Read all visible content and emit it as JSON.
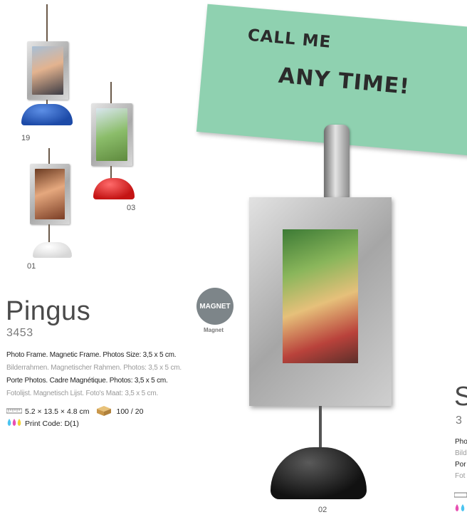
{
  "variants": [
    {
      "number": "19",
      "base_color": "#2a5fc0"
    },
    {
      "number": "03",
      "base_color": "#d82a2a"
    },
    {
      "number": "01",
      "base_color": "#f0f0f0"
    },
    {
      "number": "02",
      "base_color": "#1a1a1a"
    }
  ],
  "product": {
    "title": "Pingus",
    "code": "3453",
    "descriptions": [
      "Photo Frame. Magnetic Frame. Photos Size: 3,5 x 5 cm.",
      "Bilderrahmen. Magnetischer Rahmen. Photos: 3,5 x 5 cm.",
      "Porte Photos. Cadre Magnétique. Photos: 3,5 x 5 cm.",
      "Fotolijst. Magnetisch Lijst. Foto's Maat: 3,5 x 5 cm."
    ],
    "dimensions": "5.2 × 13.5 × 4.8 cm",
    "packaging": "100 / 20",
    "print_code": "Print Code: D(1)",
    "badge_label": "MAGNET",
    "badge_caption": "Magnet"
  },
  "note_text": {
    "line1": "CALL ME",
    "line2": "ANY TIME!"
  },
  "next_product_partial": {
    "title_letter": "S",
    "code_partial": "3",
    "line1": "Pho",
    "line2": "Bild",
    "line3": "Por",
    "line4": "Fot"
  },
  "colors": {
    "note_green": "#8fd1b0",
    "badge_gray": "#7d8589",
    "frame_silver": "#b5b5b5"
  }
}
